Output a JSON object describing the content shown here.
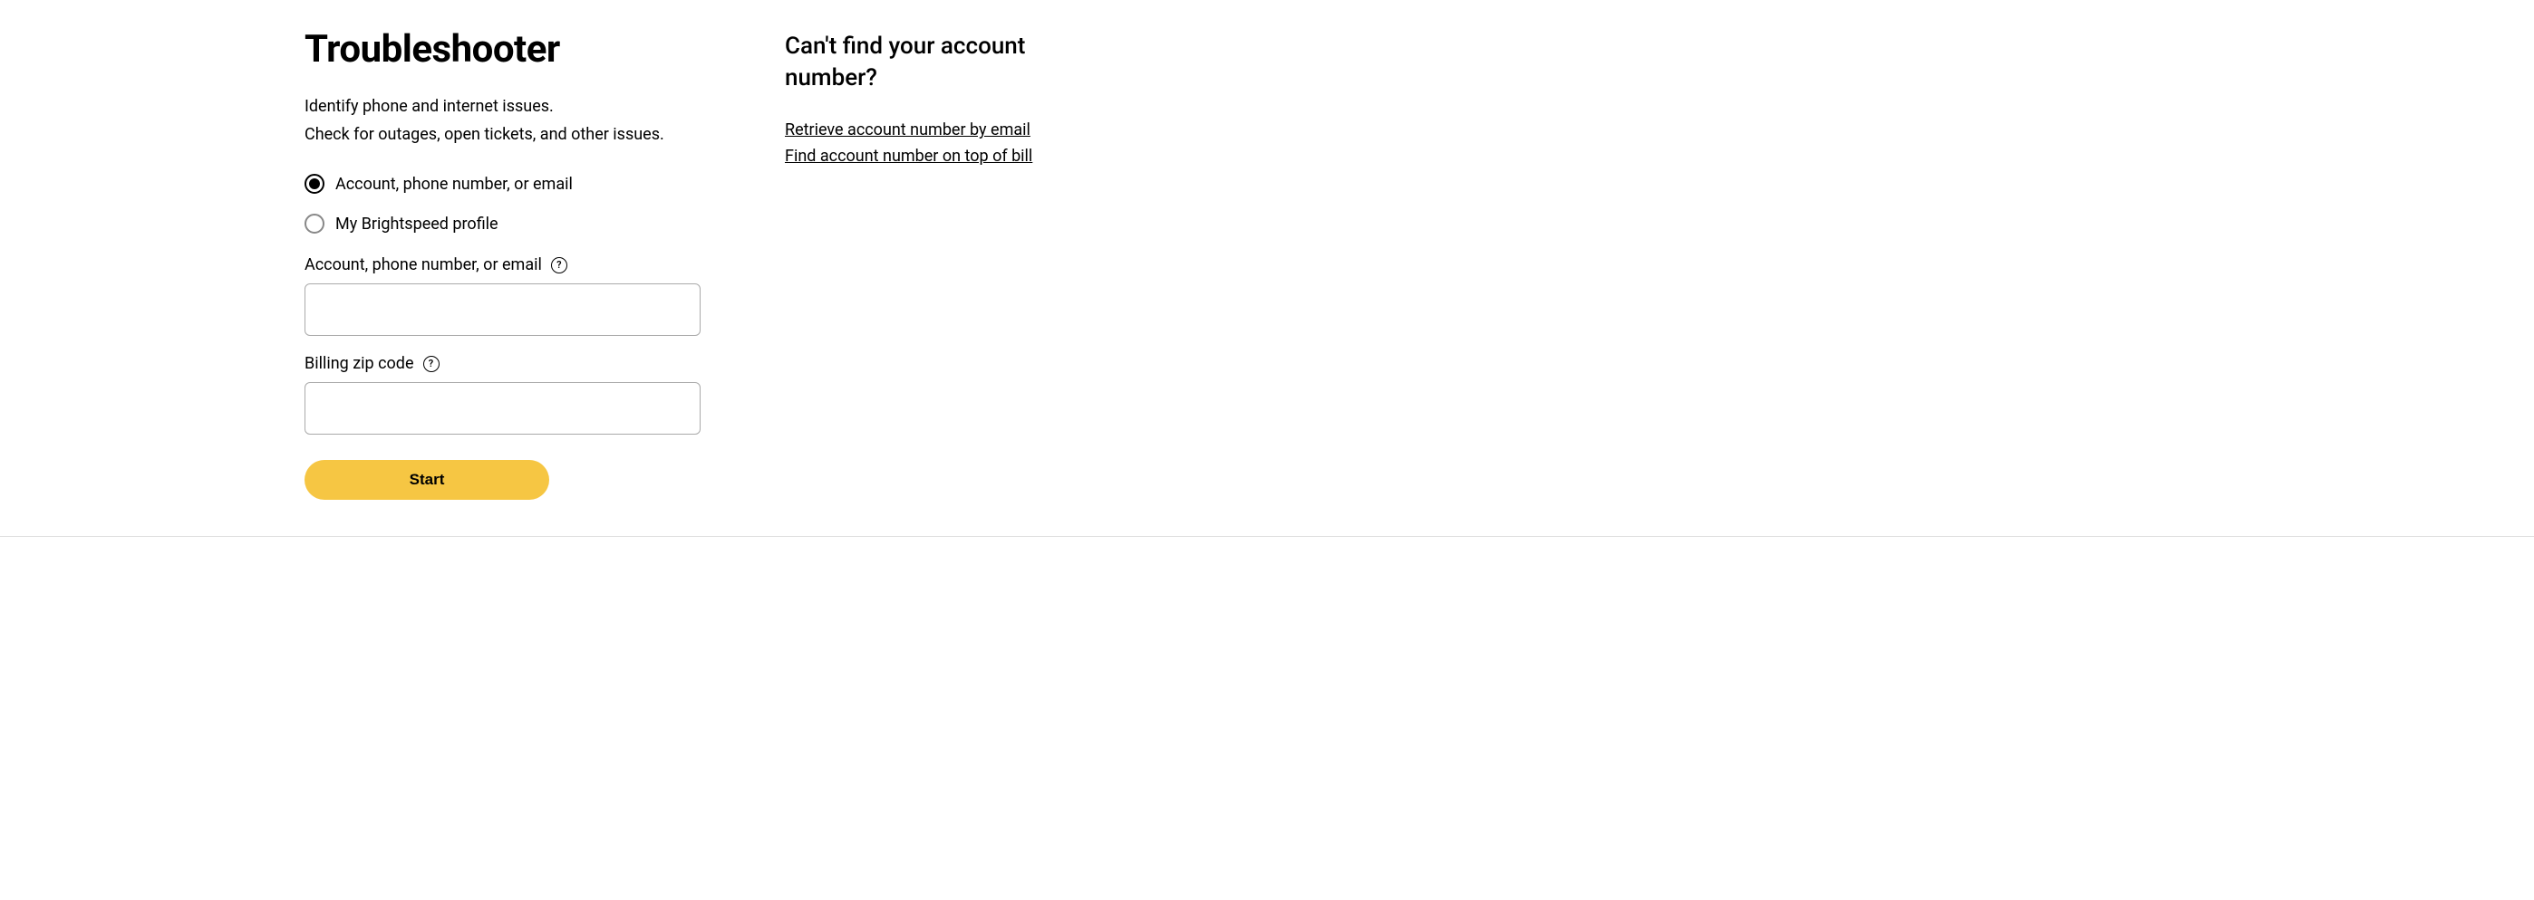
{
  "main": {
    "title": "Troubleshooter",
    "subtitle_line1": "Identify phone and internet issues.",
    "subtitle_line2": "Check for outages, open tickets, and other issues.",
    "radio_options": {
      "option1_label": "Account, phone number, or email",
      "option2_label": "My Brightspeed profile"
    },
    "fields": {
      "account_label": "Account, phone number, or email",
      "account_value": "",
      "zip_label": "Billing zip code",
      "zip_value": ""
    },
    "help_icon_text": "?",
    "start_button_label": "Start"
  },
  "sidebar": {
    "heading": "Can't find your account number?",
    "link1": "Retrieve account number by email",
    "link2": "Find account number on top of bill"
  }
}
